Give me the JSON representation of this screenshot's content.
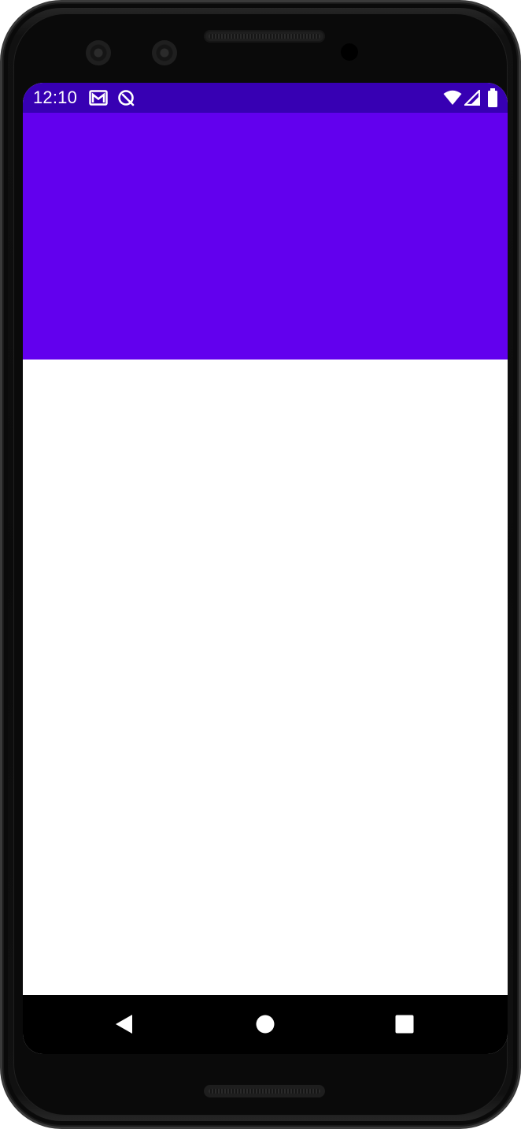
{
  "status_bar": {
    "time": "12:10",
    "icons": [
      "gmail-icon",
      "sync-icon",
      "wifi-icon",
      "signal-icon",
      "battery-icon"
    ],
    "background_color": "#3700B3"
  },
  "app_bar": {
    "background_color": "#6200EE"
  },
  "content": {
    "background_color": "#FFFFFF"
  },
  "navigation_bar": {
    "buttons": [
      "back-icon",
      "home-icon",
      "recents-icon"
    ],
    "background_color": "#000000"
  }
}
